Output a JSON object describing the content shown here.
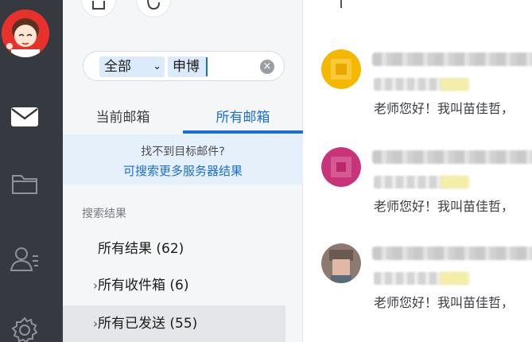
{
  "search": {
    "scope": "全部",
    "term": "申博"
  },
  "tabs": {
    "current": "当前邮箱",
    "all": "所有邮箱"
  },
  "hint": {
    "line1": "找不到目标邮件?",
    "line2": "可搜索更多服务器结果"
  },
  "results": {
    "section_title": "搜索结果",
    "items": [
      {
        "label": "所有结果 (62)"
      },
      {
        "label": "所有收件箱 (6)"
      },
      {
        "label": "所有已发送 (55)"
      }
    ]
  },
  "mails": [
    {
      "avatar_color": "#f5b800",
      "snippet": "老师您好！我叫苗佳哲，"
    },
    {
      "avatar_color": "#c9337a",
      "snippet": "老师您好！我叫苗佳哲，"
    },
    {
      "avatar_color": "#a08070",
      "snippet": "老师您好！我叫苗佳哲，"
    }
  ],
  "colors": {
    "accent": "#1a6fd6",
    "rail": "#363a40",
    "selection": "#e4e6e9"
  },
  "icons": [
    "mail-icon",
    "folder-icon",
    "contacts-icon",
    "settings-icon",
    "share-icon",
    "refresh-icon",
    "clear-icon",
    "chevron-down-icon",
    "chevron-right-icon"
  ]
}
